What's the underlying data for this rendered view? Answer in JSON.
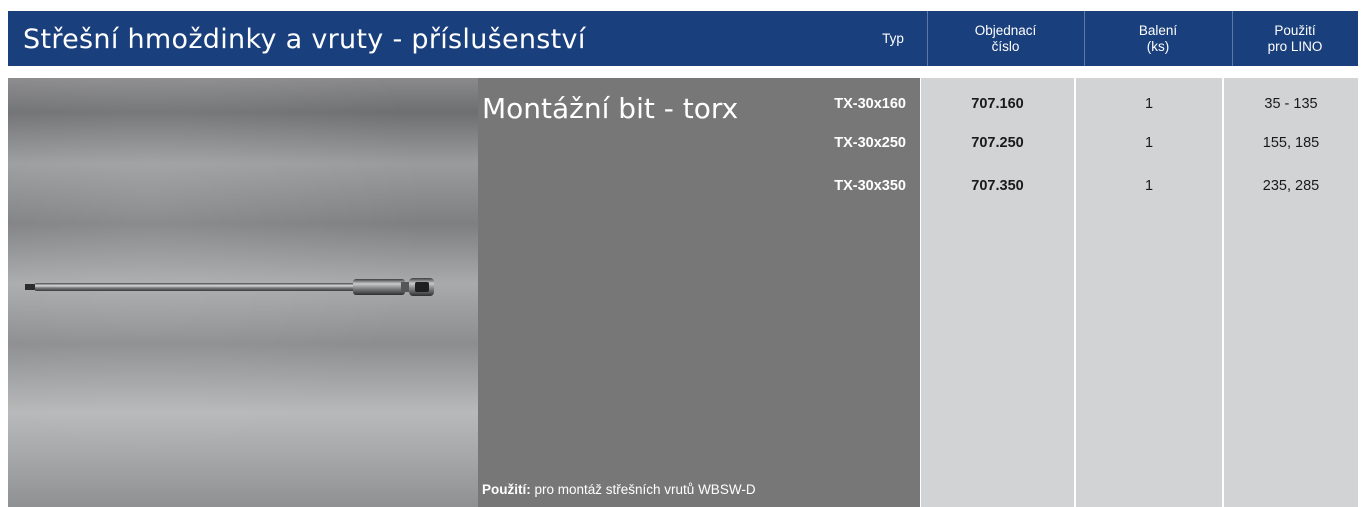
{
  "header": {
    "title": "Střešní hmoždinky a vruty - příslušenství",
    "col_typ": "Typ",
    "col_objednaci_1": "Objednací",
    "col_objednaci_2": "číslo",
    "col_baleni_1": "Balení",
    "col_baleni_2": "(ks)",
    "col_pouziti_1": "Použití",
    "col_pouziti_2": "pro LINO"
  },
  "product": {
    "title": "Montážní bit - torx",
    "usage_label": "Použití:",
    "usage_text": " pro montáž střešních vrutů WBSW-D"
  },
  "rows": [
    {
      "typ": "TX-30x160",
      "objednaci": "707.160",
      "baleni": "1",
      "pouziti": "35 - 135"
    },
    {
      "typ": "TX-30x250",
      "objednaci": "707.250",
      "baleni": "1",
      "pouziti": "155, 185"
    },
    {
      "typ": "TX-30x350",
      "objednaci": "707.350",
      "baleni": "1",
      "pouziti": "235, 285"
    }
  ],
  "colors": {
    "header_bg": "#193f7c",
    "description_bg": "#777778",
    "table_bg": "#d2d3d5"
  },
  "icons": {
    "product_image": "torx-bit-photo"
  }
}
